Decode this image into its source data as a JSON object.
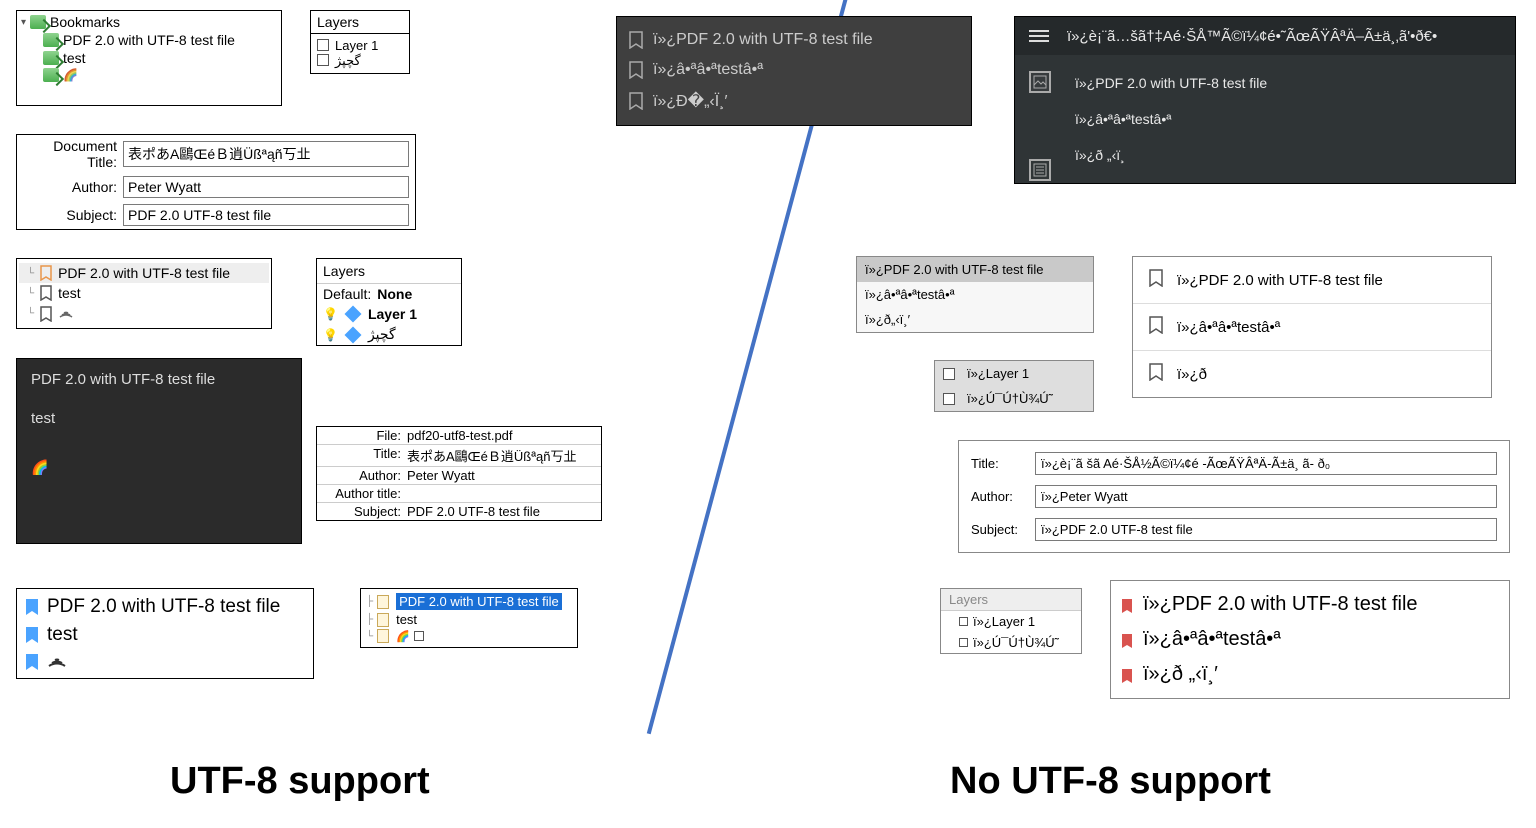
{
  "captions": {
    "left": "UTF-8 support",
    "right": "No UTF-8 support"
  },
  "left": {
    "bookmarksTree": {
      "root": "Bookmarks",
      "items": [
        "PDF 2.0 with UTF-8 test file",
        "test"
      ],
      "rainbowGlyph": "🌈"
    },
    "layersSmall": {
      "title": "Layers",
      "items": [
        "Layer 1",
        "گچپژ"
      ]
    },
    "meta1": {
      "labels": {
        "docTitle": "Document Title:",
        "author": "Author:",
        "subject": "Subject:"
      },
      "values": {
        "docTitle": "表ポあA鷗ŒéＢ逍Üßªąñ丂㐀𠀀",
        "author": "Peter Wyatt",
        "subject": "PDF 2.0 UTF-8 test file"
      }
    },
    "outlineOrange": {
      "items": [
        "PDF 2.0 with UTF-8 test file",
        "test"
      ],
      "signalGlyph": "⌇"
    },
    "layersDefault": {
      "title": "Layers",
      "defaultLabel": "Default:",
      "defaultValue": "None",
      "items": [
        "Layer 1",
        "گچپژ"
      ]
    },
    "darkPanel": {
      "title": "PDF 2.0 with UTF-8 test file",
      "sub": "test",
      "rainbow": "🌈"
    },
    "fileMeta": {
      "labels": {
        "file": "File:",
        "title": "Title:",
        "author": "Author:",
        "authorTitle": "Author title:",
        "subject": "Subject:"
      },
      "values": {
        "file": "pdf20-utf8-test.pdf",
        "title": "表ポあA鷗ŒéＢ逍Üßªąñ丂㐀𠀀",
        "author": "Peter Wyatt",
        "authorTitle": "",
        "subject": "PDF 2.0 UTF-8 test file"
      }
    },
    "blueBookmarks": {
      "items": [
        "PDF 2.0 with UTF-8 test file",
        "test"
      ],
      "wifiGlyph": "◉⦚"
    },
    "smallTree": {
      "items": [
        "PDF 2.0 with UTF-8 test file",
        "test"
      ],
      "rainbow": "🌈"
    }
  },
  "right": {
    "darkBookmarks": {
      "items": [
        "ï»¿PDF 2.0 with UTF-8 test file",
        "ï»¿â•ªâ•ªtestâ•ª",
        "ï»¿Ð�„‹Ï¸′"
      ]
    },
    "mobileDark": {
      "title": "ï»¿è¡¨ã…šã†‡Aé·ŠÅ™Ã©ï¼¢é•˜ÃœÃŸÂªÄ–Ã±ä¸‚ã'•ð€•",
      "items": [
        "ï»¿PDF 2.0 with UTF-8 test file",
        "ï»¿â•ªâ•ªtestâ•ª",
        "ï»¿ð „‹ï¸"
      ]
    },
    "grayStack": {
      "items": [
        "ï»¿PDF 2.0 with UTF-8 test file",
        "ï»¿â•ªâ•ªtestâ•ª",
        "ï»¿ð„‹ï¸′"
      ]
    },
    "whiteOutline": {
      "items": [
        "ï»¿PDF 2.0 with UTF-8 test file",
        "ï»¿â•ªâ•ªtestâ•ª",
        "ï»¿ð"
      ]
    },
    "layersSmall": {
      "items": [
        "ï»¿Layer 1",
        "ï»¿Ú¯Ú†Ù¾Ú˜"
      ]
    },
    "meta": {
      "labels": {
        "title": "Title:",
        "author": "Author:",
        "subject": "Subject:"
      },
      "values": {
        "title": "ï»¿è¡¨ã šã   Aé·ŠÅ½Ã©ï¼¢é -ÃœÃŸÂªÄ-Ã±ä¸   ã-  ð₀",
        "author": "ï»¿Peter Wyatt",
        "subject": "ï»¿PDF 2.0 UTF-8 test file"
      }
    },
    "layersGray": {
      "title": "Layers",
      "items": [
        "ï»¿Layer 1",
        "ï»¿Ú¯Ú†Ù¾Ú˜"
      ]
    },
    "redBookmarks": {
      "items": [
        "ï»¿PDF 2.0 with UTF-8 test file",
        "ï»¿â•ªâ•ªtestâ•ª",
        "ï»¿ð „‹ï¸′"
      ]
    }
  }
}
